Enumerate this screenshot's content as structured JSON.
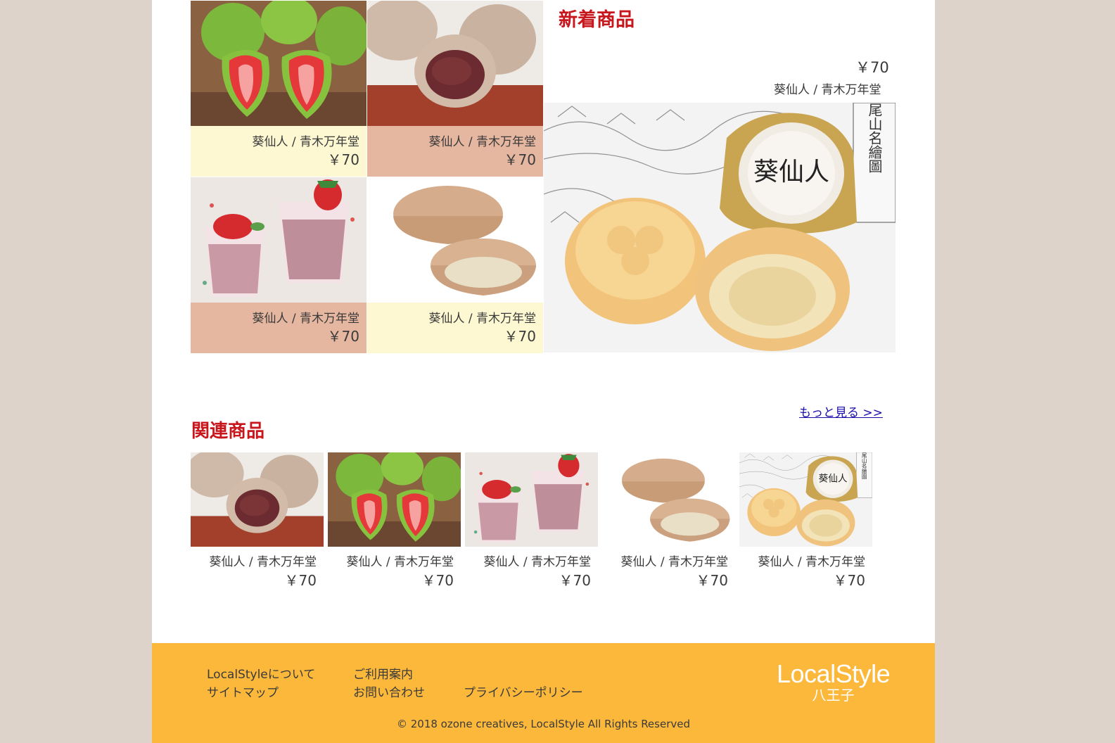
{
  "new_products": {
    "title": "新着商品",
    "items": [
      {
        "name": "葵仙人 / 青木万年堂",
        "price": "￥70",
        "image": "strawberry-daifuku-green"
      },
      {
        "name": "葵仙人 / 青木万年堂",
        "price": "￥70",
        "image": "anko-daifuku"
      },
      {
        "name": "葵仙人 / 青木万年堂",
        "price": "￥70",
        "image": "strawberry-mousse-cups"
      },
      {
        "name": "葵仙人 / 青木万年堂",
        "price": "￥70",
        "image": "white-bean-manju"
      }
    ],
    "featured": {
      "name": "葵仙人 / 青木万年堂",
      "price": "￥70",
      "image": "aoi-sennin-baked-manju"
    }
  },
  "more_link": "もっと見る >>",
  "related": {
    "title": "関連商品",
    "items": [
      {
        "name": "葵仙人 / 青木万年堂",
        "price": "￥70",
        "image": "anko-daifuku"
      },
      {
        "name": "葵仙人 / 青木万年堂",
        "price": "￥70",
        "image": "strawberry-daifuku-green"
      },
      {
        "name": "葵仙人 / 青木万年堂",
        "price": "￥70",
        "image": "strawberry-mousse-cups"
      },
      {
        "name": "葵仙人 / 青木万年堂",
        "price": "￥70",
        "image": "white-bean-manju"
      },
      {
        "name": "葵仙人 / 青木万年堂",
        "price": "￥70",
        "image": "aoi-sennin-baked-manju"
      }
    ]
  },
  "footer": {
    "links": {
      "about": "LocalStyleについて",
      "guide": "ご利用案内",
      "sitemap": "サイトマップ",
      "contact": "お問い合わせ",
      "privacy": "プライバシーポリシー"
    },
    "logo": {
      "line1": "LocalStyle",
      "line2": "八王子"
    },
    "copyright": "© 2018 ozone creatives, LocalStyle All Rights Reserved"
  },
  "colors": {
    "background": "#ddd3cb",
    "heading_red": "#c8161d",
    "footer_orange": "#fcb83b",
    "caption_cream": "#fdf8d2",
    "caption_peach": "#e5b6a0",
    "link_blue": "#1a0dab"
  }
}
